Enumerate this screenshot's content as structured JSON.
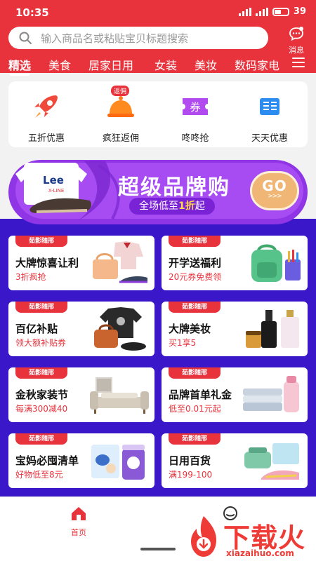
{
  "status_bar": {
    "time": "10:35",
    "battery": "39"
  },
  "search": {
    "placeholder": "输入商品名或粘贴宝贝标题搜索"
  },
  "messages": {
    "label": "消息"
  },
  "tabs": [
    {
      "label": "精选",
      "active": true
    },
    {
      "label": "美食"
    },
    {
      "label": "居家日用"
    },
    {
      "label": "女装"
    },
    {
      "label": "美妆"
    },
    {
      "label": "数码家电"
    }
  ],
  "quick_features": [
    {
      "label": "五折优惠",
      "icon": "rocket-icon"
    },
    {
      "label": "疯狂返佣",
      "icon": "cloche-icon",
      "badge": "返佣"
    },
    {
      "label": "咚咚抢",
      "icon": "coupon-icon",
      "glyph": "券"
    },
    {
      "label": "天天优惠",
      "icon": "book-icon"
    }
  ],
  "banner": {
    "title": "超级品牌购",
    "subtitle_prefix": "全场低至",
    "subtitle_highlight": "1折",
    "subtitle_suffix": "起",
    "go_label": "GO",
    "go_arrows": ">>>",
    "product_brand": "Lee",
    "product_sub": "X-LINE"
  },
  "promos": [
    {
      "tag": "茹影随邢",
      "title": "大牌惊喜让利",
      "subtitle": "3折疯抢"
    },
    {
      "tag": "茹影随邢",
      "title": "开学送福利",
      "subtitle": "20元券免费领"
    },
    {
      "tag": "茹影随邢",
      "title": "百亿补贴",
      "subtitle": "领大额补贴券"
    },
    {
      "tag": "茹影随邢",
      "title": "大牌美妆",
      "subtitle": "买1享5"
    },
    {
      "tag": "茹影随邢",
      "title": "金秋家装节",
      "subtitle": "每满300减40"
    },
    {
      "tag": "茹影随邢",
      "title": "品牌首单礼金",
      "subtitle": "低至0.01元起"
    },
    {
      "tag": "茹影随邢",
      "title": "宝妈必囤清单",
      "subtitle": "好物低至8元"
    },
    {
      "tag": "茹影随邢",
      "title": "日用百货",
      "subtitle": "满199-100"
    }
  ],
  "bottom_nav": [
    {
      "label": "首页",
      "icon": "home-icon",
      "active": true
    },
    {
      "label": "",
      "icon": "chat-icon"
    }
  ],
  "watermark": {
    "text": "下载火",
    "url": "xiazaihuo.com"
  },
  "colors": {
    "brand_red": "#e8323c",
    "promo_bg": "#3a17c9",
    "banner_purple": "#7a22d6"
  }
}
